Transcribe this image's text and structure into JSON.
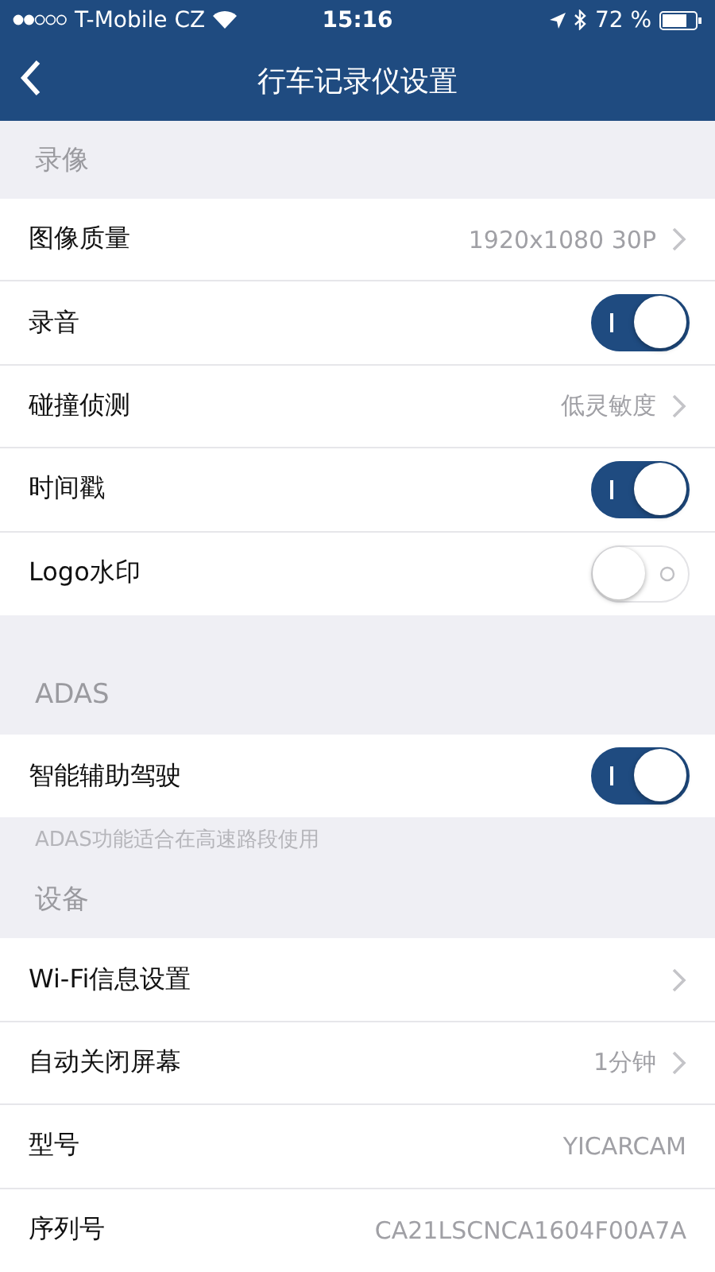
{
  "status_bar": {
    "carrier": "T-Mobile CZ",
    "time": "15:16",
    "battery": "72 %"
  },
  "nav": {
    "title": "行车记录仪设置"
  },
  "sections": [
    {
      "title": "录像",
      "rows": [
        {
          "kind": "value",
          "label": "图像质量",
          "value": "1920x1080 30P",
          "chevron": true
        },
        {
          "kind": "toggle",
          "label": "录音",
          "on": true
        },
        {
          "kind": "value",
          "label": "碰撞侦测",
          "value": "低灵敏度",
          "chevron": true
        },
        {
          "kind": "toggle",
          "label": "时间戳",
          "on": true
        },
        {
          "kind": "toggle",
          "label": "Logo水印",
          "on": false
        }
      ]
    },
    {
      "title": "ADAS",
      "rows": [
        {
          "kind": "toggle",
          "label": "智能辅助驾驶",
          "on": true
        }
      ],
      "note": "ADAS功能适合在高速路段使用"
    },
    {
      "title": "设备",
      "rows": [
        {
          "kind": "value",
          "label": "Wi-Fi信息设置",
          "chevron": true
        },
        {
          "kind": "value",
          "label": "自动关闭屏幕",
          "value": "1分钟",
          "chevron": true
        },
        {
          "kind": "value",
          "label": "型号",
          "value": "YICARCAM",
          "chevron": false
        },
        {
          "kind": "value",
          "label": "序列号",
          "value": "CA21LSCNCA1604F00A7A",
          "chevron": false
        }
      ]
    }
  ]
}
